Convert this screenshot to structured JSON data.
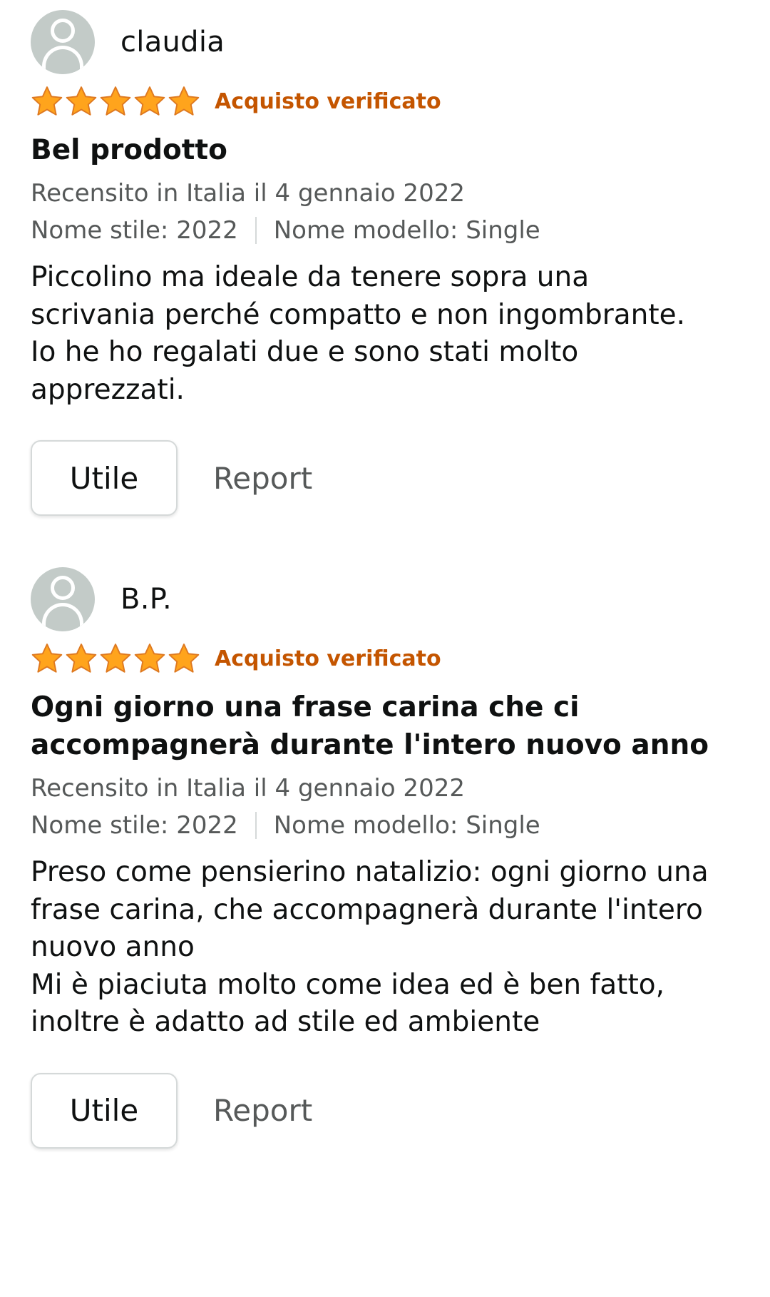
{
  "reviews": [
    {
      "reviewer": "claudia",
      "rating": 5,
      "verified_label": "Acquisto verificato",
      "title": "Bel prodotto",
      "date_text": "Recensito in Italia il 4 gennaio 2022",
      "style_text": "Nome stile: 2022",
      "model_text": "Nome modello: Single",
      "body": "Piccolino ma ideale da tenere sopra una\nscrivania perché compatto e non ingombrante.\nIo he ho regalati due e sono stati molto\napprezzati.",
      "helpful_label": "Utile",
      "report_label": "Report"
    },
    {
      "reviewer": "B.P.",
      "rating": 5,
      "verified_label": "Acquisto verificato",
      "title": "Ogni giorno una frase carina che ci\naccompagnerà durante l'intero nuovo anno",
      "date_text": "Recensito in Italia il 4 gennaio 2022",
      "style_text": "Nome stile: 2022",
      "model_text": "Nome modello: Single",
      "body": "Preso come pensierino natalizio: ogni giorno una\nfrase carina, che accompagnerà durante l'intero\nnuovo anno\nMi è piaciuta molto come idea ed è ben fatto,\ninoltre è adatto ad stile ed ambiente",
      "helpful_label": "Utile",
      "report_label": "Report"
    }
  ],
  "colors": {
    "star_fill": "#ffa41c",
    "star_stroke": "#de7921",
    "verified": "#c45500",
    "secondary_text": "#565959",
    "avatar_bg": "#c3cbc8"
  },
  "icons": {
    "avatar": "user-avatar-icon",
    "star": "star-filled-icon"
  }
}
